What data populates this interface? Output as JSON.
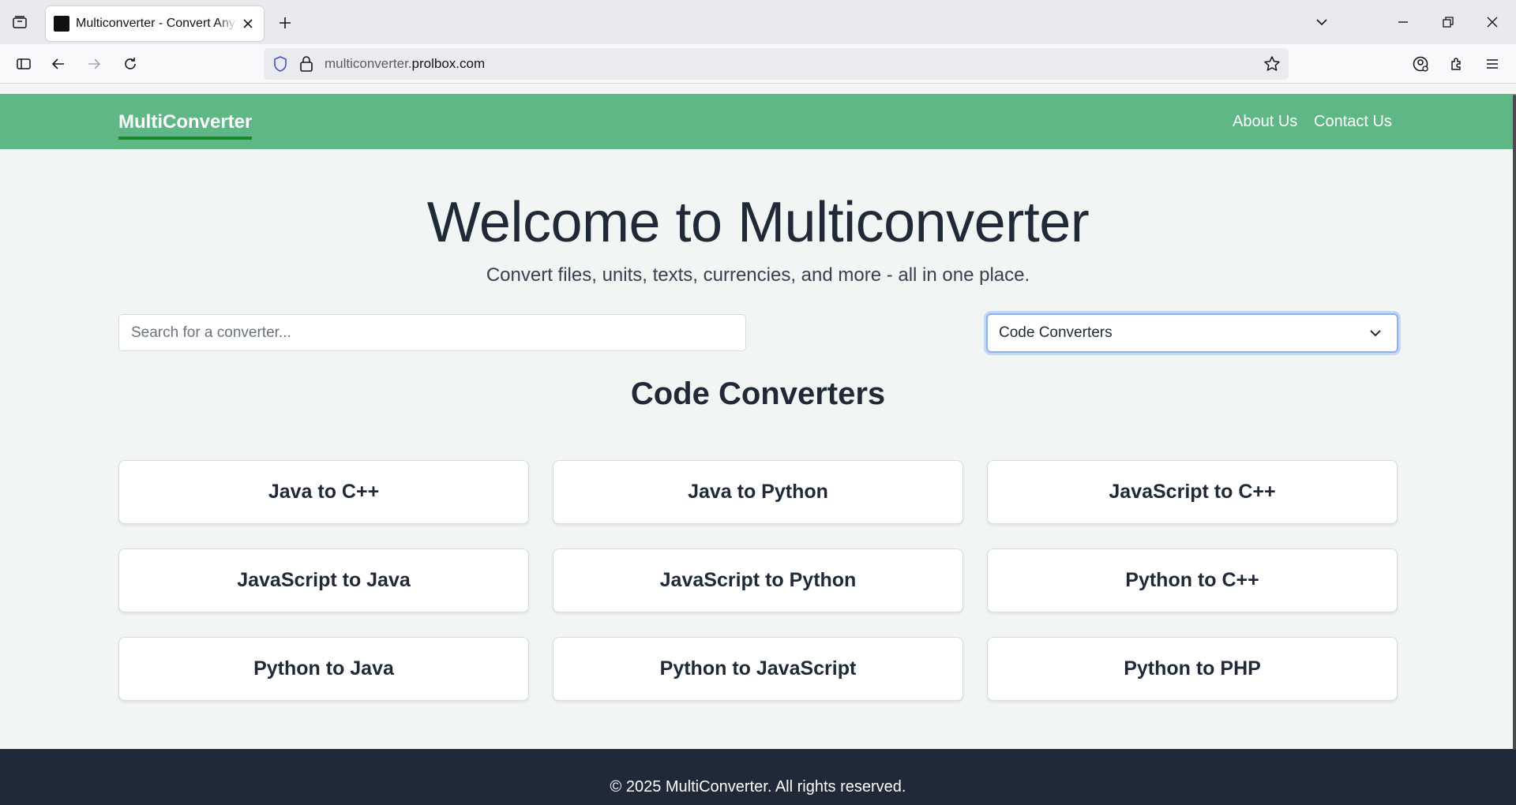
{
  "browser": {
    "tab_title": "Multiconverter - Convert Anything",
    "url_prefix": "multiconverter.",
    "url_domain": "prolbox.com"
  },
  "header": {
    "brand": "MultiConverter",
    "nav": [
      {
        "label": "About Us"
      },
      {
        "label": "Contact Us"
      }
    ],
    "brand_color": "#5fb785"
  },
  "hero": {
    "title": "Welcome to Multiconverter",
    "subtitle": "Convert files, units, texts, currencies, and more - all in one place."
  },
  "search": {
    "placeholder": "Search for a converter..."
  },
  "category_select": {
    "selected": "Code Converters"
  },
  "section": {
    "title": "Code Converters",
    "converters": [
      {
        "label": "Java to C++"
      },
      {
        "label": "Java to Python"
      },
      {
        "label": "JavaScript to C++"
      },
      {
        "label": "JavaScript to Java"
      },
      {
        "label": "JavaScript to Python"
      },
      {
        "label": "Python to C++"
      },
      {
        "label": "Python to Java"
      },
      {
        "label": "Python to JavaScript"
      },
      {
        "label": "Python to PHP"
      }
    ]
  },
  "footer": {
    "text": "© 2025 MultiConverter. All rights reserved.",
    "color": "#1f2937"
  }
}
